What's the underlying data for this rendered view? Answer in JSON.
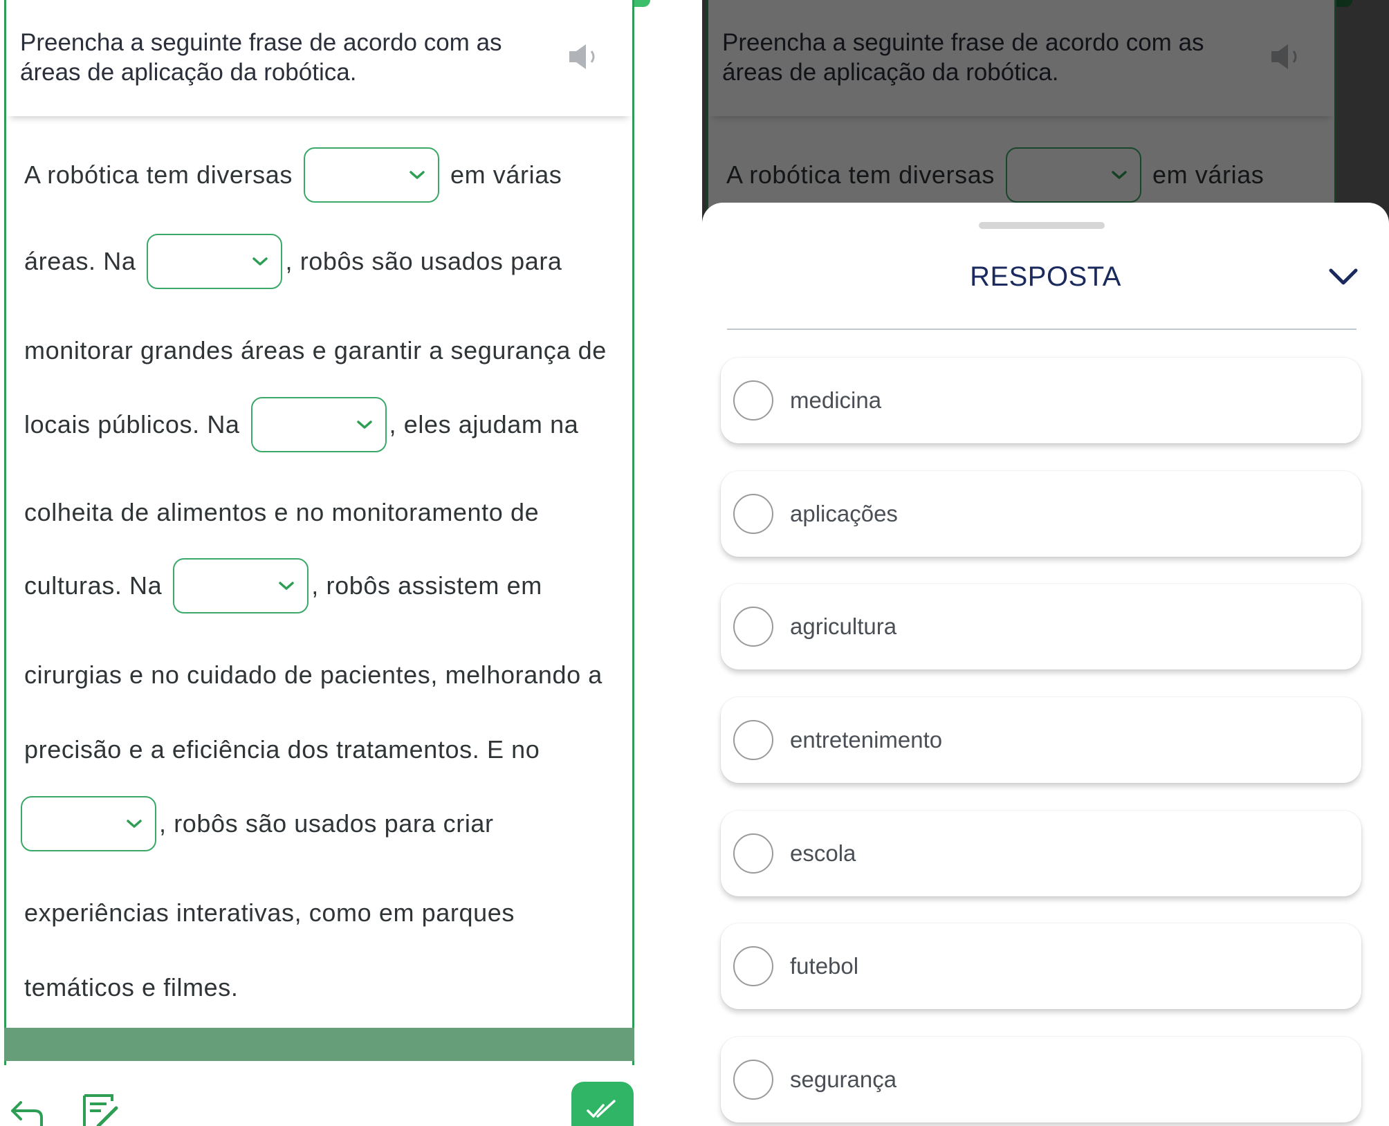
{
  "question": {
    "prompt": "Preencha a seguinte frase de acordo com as áreas de aplicação da robótica.",
    "prompt_line1": "Preencha a seguinte frase de acordo com as",
    "prompt_line2": "áreas de aplicação da robótica."
  },
  "sentence": {
    "l1_a": "A robótica tem diversas",
    "l1_b": "em várias",
    "l2_a": "áreas. Na",
    "l2_b": ", robôs são usados para",
    "l3": "monitorar grandes áreas e garantir a segurança de",
    "l4_a": "locais públicos. Na",
    "l4_b": ", eles ajudam na",
    "l5": "colheita de alimentos e no monitoramento de",
    "l6_a": "culturas. Na",
    "l6_b": ", robôs assistem em",
    "l7": "cirurgias e no cuidado de pacientes, melhorando a",
    "l8": "precisão e a eficiência dos tratamentos. E no",
    "l9_b": ", robôs são usados para criar",
    "l10": "experiências interativas, como em parques",
    "l11": "temáticos e filmes."
  },
  "answer_sheet": {
    "title": "RESPOSTA",
    "options": [
      "medicina",
      "aplicações",
      "agricultura",
      "entretenimento",
      "escola",
      "futebol",
      "segurança"
    ]
  },
  "icons": {
    "speaker": "speaker-icon",
    "chevron": "chevron-down-icon",
    "back": "back-arrow-icon",
    "notes": "edit-notes-icon",
    "check": "double-check-icon"
  },
  "colors": {
    "accent_green": "#3aa866",
    "title_navy": "#1b2a5c",
    "fab_green": "#2fb565"
  }
}
